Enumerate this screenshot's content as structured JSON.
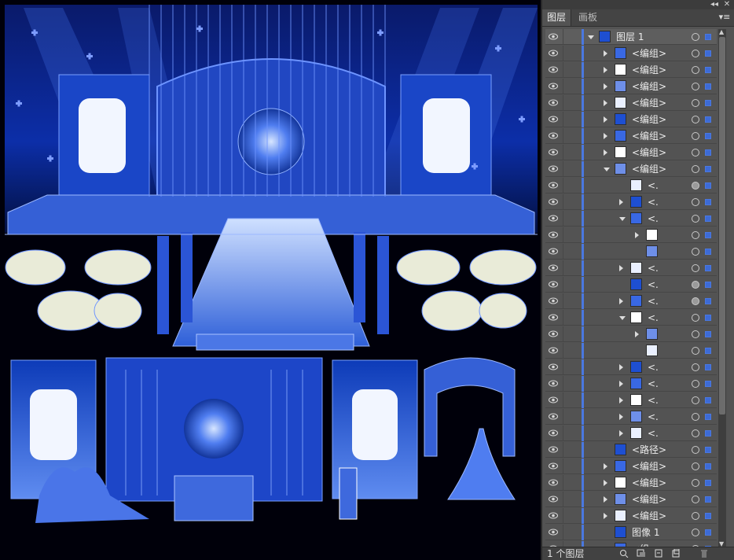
{
  "panel": {
    "tabs": [
      "图层",
      "画板"
    ],
    "footer_label": "1 个图层",
    "accent_color": "#4a78e0"
  },
  "layers": [
    {
      "name": "图层 1",
      "depth": 0,
      "expand": "down",
      "top": true
    },
    {
      "name": "<编组>",
      "depth": 1,
      "expand": "right"
    },
    {
      "name": "<编组>",
      "depth": 1,
      "expand": "right"
    },
    {
      "name": "<编组>",
      "depth": 1,
      "expand": "right"
    },
    {
      "name": "<编组>",
      "depth": 1,
      "expand": "right"
    },
    {
      "name": "<编组>",
      "depth": 1,
      "expand": "right"
    },
    {
      "name": "<编组>",
      "depth": 1,
      "expand": "right"
    },
    {
      "name": "<编组>",
      "depth": 1,
      "expand": "right"
    },
    {
      "name": "<编组>",
      "depth": 1,
      "expand": "down"
    },
    {
      "name": "<.",
      "depth": 2,
      "expand": "none",
      "filled": true
    },
    {
      "name": "<.",
      "depth": 2,
      "expand": "right"
    },
    {
      "name": "<.",
      "depth": 2,
      "expand": "down"
    },
    {
      "name": "",
      "depth": 3,
      "expand": "right"
    },
    {
      "name": "",
      "depth": 3,
      "expand": "none"
    },
    {
      "name": "<.",
      "depth": 2,
      "expand": "right"
    },
    {
      "name": "<.",
      "depth": 2,
      "expand": "none",
      "filled": true
    },
    {
      "name": "<.",
      "depth": 2,
      "expand": "right",
      "filled": true
    },
    {
      "name": "<.",
      "depth": 2,
      "expand": "down"
    },
    {
      "name": "",
      "depth": 3,
      "expand": "right"
    },
    {
      "name": "",
      "depth": 3,
      "expand": "none"
    },
    {
      "name": "<.",
      "depth": 2,
      "expand": "right"
    },
    {
      "name": "<.",
      "depth": 2,
      "expand": "right"
    },
    {
      "name": "<.",
      "depth": 2,
      "expand": "right"
    },
    {
      "name": "<.",
      "depth": 2,
      "expand": "right"
    },
    {
      "name": "<.",
      "depth": 2,
      "expand": "right"
    },
    {
      "name": "<路径>",
      "depth": 1,
      "expand": "none"
    },
    {
      "name": "<编组>",
      "depth": 1,
      "expand": "right"
    },
    {
      "name": "<编组>",
      "depth": 1,
      "expand": "right"
    },
    {
      "name": "<编组>",
      "depth": 1,
      "expand": "right"
    },
    {
      "name": "<编组>",
      "depth": 1,
      "expand": "right"
    },
    {
      "name": "图像 1",
      "depth": 1,
      "expand": "none"
    },
    {
      "name": "<组",
      "depth": 1,
      "expand": "none"
    }
  ]
}
